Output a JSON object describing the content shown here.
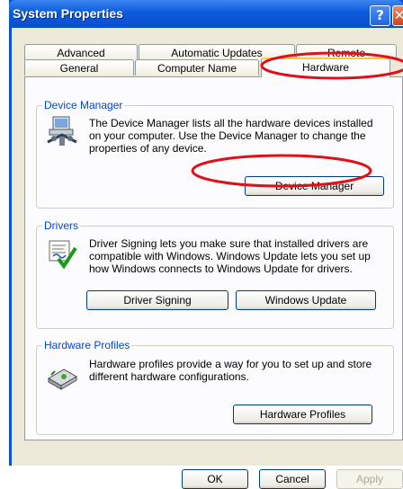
{
  "window": {
    "title": "System Properties",
    "help_glyph": "?",
    "close_glyph": "✕"
  },
  "tabs": {
    "row1": [
      "Advanced",
      "Automatic Updates",
      "Remote"
    ],
    "row2": [
      "General",
      "Computer Name",
      "Hardware"
    ],
    "selected": "Hardware"
  },
  "device_manager": {
    "label": "Device Manager",
    "description": "The Device Manager lists all the hardware devices installed on your computer. Use the Device Manager to change the properties of any device.",
    "button": "Device Manager",
    "icon": "device-manager-icon"
  },
  "drivers": {
    "label": "Drivers",
    "description": "Driver Signing lets you make sure that installed drivers are compatible with Windows. Windows Update lets you set up how Windows connects to Windows Update for drivers.",
    "driver_signing_button": "Driver Signing",
    "windows_update_button": "Windows Update",
    "icon": "driver-signing-icon"
  },
  "hardware_profiles": {
    "label": "Hardware Profiles",
    "description": "Hardware profiles provide a way for you to set up and store different hardware configurations.",
    "button": "Hardware Profiles",
    "icon": "hardware-profiles-icon"
  },
  "dialog_buttons": {
    "ok": "OK",
    "cancel": "Cancel",
    "apply": "Apply"
  },
  "colors": {
    "title_blue": "#0a50d8",
    "annotation_red": "#e0101a",
    "group_label": "#0046d5"
  }
}
